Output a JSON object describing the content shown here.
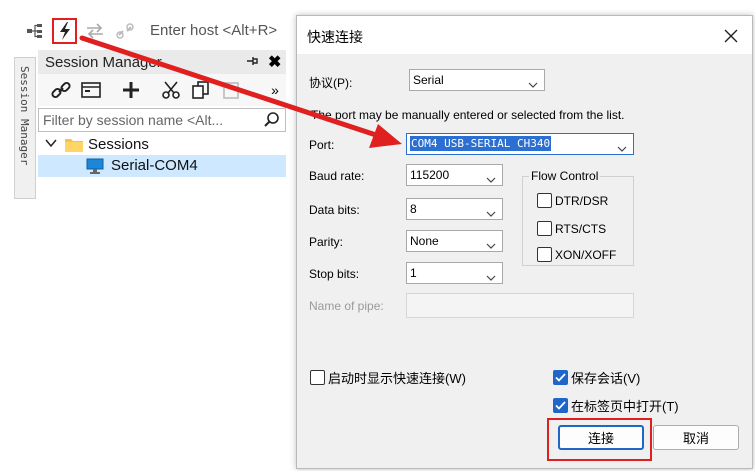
{
  "toolbar": {
    "host_placeholder": "Enter host <Alt+R>",
    "icons": [
      "session-tree-icon",
      "quick-connect-lightning-icon",
      "reconnect-arrows-icon",
      "disconnect-link-icon"
    ]
  },
  "side_tab": {
    "label": "Session Manager"
  },
  "session_manager": {
    "title": "Session Manager",
    "pin": "→",
    "close": "✖",
    "more": "»",
    "filter_placeholder": "Filter by session name <Alt...",
    "tree": {
      "root": {
        "label": "Sessions",
        "expander": "∨"
      },
      "child": {
        "label": "Serial-COM4",
        "selected": true
      }
    }
  },
  "dialog": {
    "title": "快速连接",
    "protocol_label": "协议(P):",
    "protocol_value": "Serial",
    "hint": "The port may be manually entered or selected from the list.",
    "port_label": "Port:",
    "port_value": "COM4 USB-SERIAL CH340",
    "baud_label": "Baud rate:",
    "baud_value": "115200",
    "data_bits_label": "Data bits:",
    "data_bits_value": "8",
    "parity_label": "Parity:",
    "parity_value": "None",
    "stop_bits_label": "Stop bits:",
    "stop_bits_value": "1",
    "pipe_label": "Name of pipe:",
    "flow_control": {
      "title": "Flow Control",
      "dtr_dsr": {
        "label": "DTR/DSR",
        "checked": false
      },
      "rts_cts": {
        "label": "RTS/CTS",
        "checked": false
      },
      "xon_xoff": {
        "label": "XON/XOFF",
        "checked": false
      }
    },
    "show_on_startup": {
      "label": "启动时显示快速连接(W)",
      "checked": false
    },
    "save_session": {
      "label": "保存会话(V)",
      "checked": true
    },
    "open_in_tab": {
      "label": "在标签页中打开(T)",
      "checked": true
    },
    "connect_button": "连接",
    "cancel_button": "取消"
  },
  "colors": {
    "highlight_red": "#e02020",
    "accent_blue": "#1f66c8",
    "selection_bg": "#cde8ff"
  }
}
